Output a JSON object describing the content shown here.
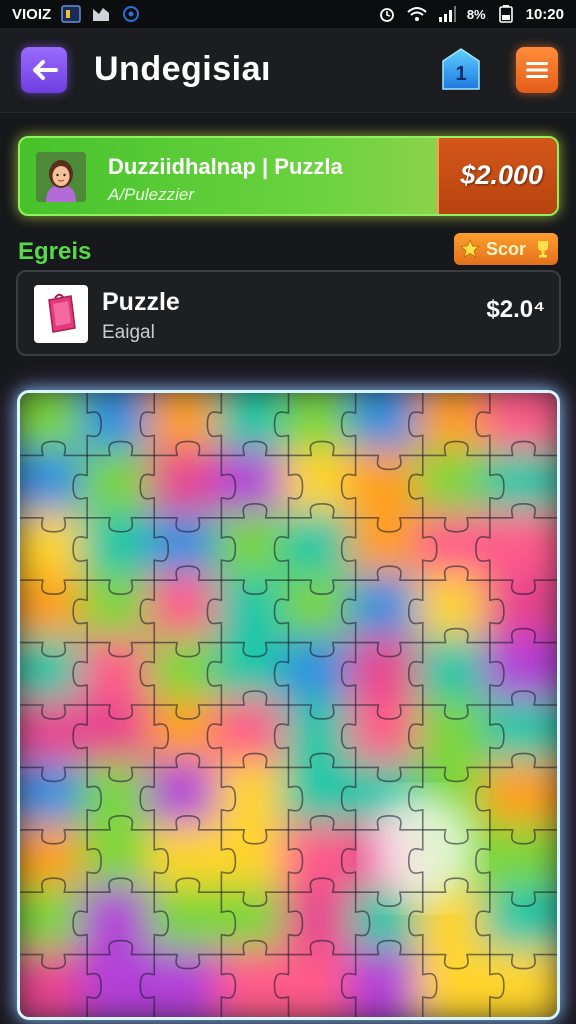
{
  "status_bar": {
    "carrier": "VIOIZ",
    "battery_percent": "8%",
    "time": "10:20"
  },
  "header": {
    "title": "Undegisiaı",
    "level_badge": "1"
  },
  "player": {
    "name": "Duzziidhalnap | Puzzla",
    "subtitle": "A/Pulezzier",
    "price": "$2.000"
  },
  "section": {
    "label": "Egreis",
    "score_button": "Scor"
  },
  "item": {
    "name": "Puzzle",
    "subtitle": "Eaigal",
    "price": "$2.0⁴"
  },
  "board": {
    "columns": 8,
    "rows": 10,
    "colors": [
      "#ff9f1c",
      "#18c7a8",
      "#e8448f",
      "#7bd63a",
      "#2f8fe0",
      "#ffd42a",
      "#b33fd8",
      "#ff5a8a"
    ]
  },
  "icons": {
    "back": "back-arrow-icon",
    "level": "level-badge-icon",
    "menu": "hamburger-menu-icon",
    "score": "star-icon"
  }
}
